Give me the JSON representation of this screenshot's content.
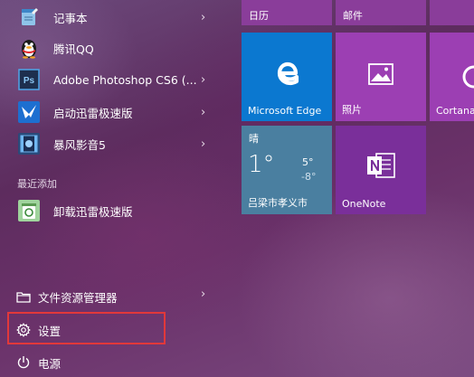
{
  "apps": [
    {
      "name": "notepad",
      "label": "记事本",
      "has_arrow": true
    },
    {
      "name": "qq",
      "label": "腾讯QQ",
      "has_arrow": false
    },
    {
      "name": "photoshop",
      "label": "Adobe Photoshop CS6 (...",
      "has_arrow": true
    },
    {
      "name": "xunlei",
      "label": "启动迅雷极速版",
      "has_arrow": true
    },
    {
      "name": "baofeng",
      "label": "暴风影音5",
      "has_arrow": true
    }
  ],
  "recently_added": {
    "heading": "最近添加",
    "item": "卸载迅雷极速版"
  },
  "system": {
    "file_explorer": "文件资源管理器",
    "settings": "设置",
    "power": "电源"
  },
  "arrow_glyph": "›",
  "tiles": {
    "calendar": "日历",
    "mail": "邮件",
    "edge": "Microsoft Edge",
    "photos": "照片",
    "cortana": "Cortana",
    "weather": {
      "condition": "晴",
      "temp": "1°",
      "high": "5°",
      "low": "-8°",
      "city": "吕梁市孝义市"
    },
    "onenote": "OneNote"
  },
  "colors": {
    "tile_purple": "#9c3fb3",
    "edge_blue": "#0b78d0",
    "weather_blue": "#4a7fa0",
    "onenote_purple": "#7a2f9a",
    "highlight_red": "#e2383a"
  }
}
